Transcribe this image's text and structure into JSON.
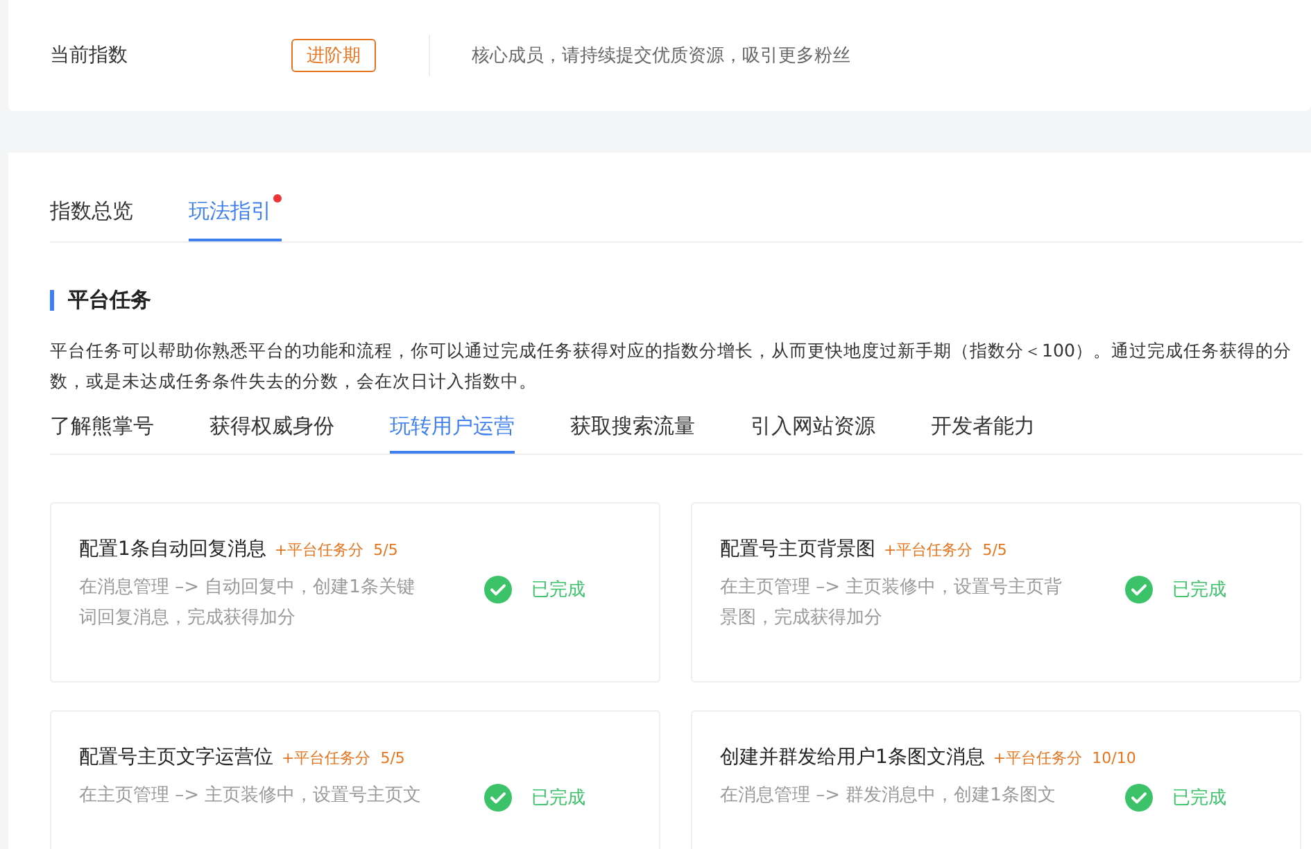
{
  "index_card": {
    "label": "当前指数",
    "stage_tag": "进阶期",
    "message": "核心成员，请持续提交优质资源，吸引更多粉丝"
  },
  "main_tabs": [
    {
      "label": "指数总览",
      "selected": false,
      "dot": false
    },
    {
      "label": "玩法指引",
      "selected": true,
      "dot": true
    }
  ],
  "section": {
    "title": "平台任务",
    "description": "平台任务可以帮助你熟悉平台的功能和流程，你可以通过完成任务获得对应的指数分增长，从而更快地度过新手期（指数分＜100）。通过完成任务获得的分数，或是未达成任务条件失去的分数，会在次日计入指数中。"
  },
  "task_tabs": [
    {
      "label": "了解熊掌号",
      "selected": false
    },
    {
      "label": "获得权威身份",
      "selected": false
    },
    {
      "label": "玩转用户运营",
      "selected": true
    },
    {
      "label": "获取搜索流量",
      "selected": false
    },
    {
      "label": "引入网站资源",
      "selected": false
    },
    {
      "label": "开发者能力",
      "selected": false
    }
  ],
  "tasks": [
    {
      "title": "配置1条自动回复消息",
      "points": "+平台任务分  5/5",
      "description": "在消息管理 –> 自动回复中，创建1条关键词回复消息，完成获得加分",
      "done": true,
      "status": "已完成"
    },
    {
      "title": "配置号主页背景图",
      "points": "+平台任务分  5/5",
      "description": "在主页管理 –> 主页装修中，设置号主页背景图，完成获得加分",
      "done": true,
      "status": "已完成"
    },
    {
      "title": "配置号主页文字运营位",
      "points": "+平台任务分  5/5",
      "description": "在主页管理 –> 主页装修中，设置号主页文",
      "done": true,
      "status": "已完成"
    },
    {
      "title": "创建并群发给用户1条图文消息",
      "points": "+平台任务分  10/10",
      "description": "在消息管理 –> 群发消息中，创建1条图文",
      "done": true,
      "status": "已完成"
    }
  ]
}
